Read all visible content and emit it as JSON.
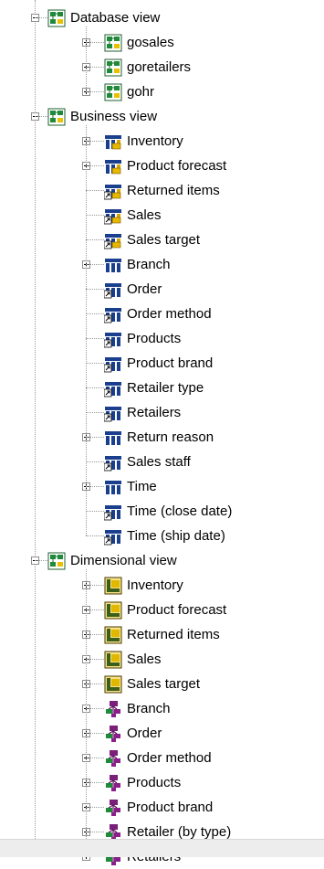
{
  "tree": {
    "groups": [
      {
        "label": "Database view",
        "icon": "namespace-icon",
        "children": [
          {
            "label": "gosales",
            "icon": "namespace-icon",
            "expandable": true
          },
          {
            "label": "goretailers",
            "icon": "namespace-icon",
            "expandable": true
          },
          {
            "label": "gohr",
            "icon": "namespace-icon",
            "expandable": true
          }
        ]
      },
      {
        "label": "Business view",
        "icon": "namespace-icon",
        "children": [
          {
            "label": "Inventory",
            "icon": "fact-query-subject-icon",
            "expandable": true
          },
          {
            "label": "Product forecast",
            "icon": "fact-query-subject-icon",
            "expandable": true
          },
          {
            "label": "Returned items",
            "icon": "fact-query-subject-shortcut-icon",
            "expandable": false
          },
          {
            "label": "Sales",
            "icon": "fact-query-subject-shortcut-icon",
            "expandable": false
          },
          {
            "label": "Sales target",
            "icon": "fact-query-subject-shortcut-icon",
            "expandable": false
          },
          {
            "label": "Branch",
            "icon": "dimension-query-subject-icon",
            "expandable": true
          },
          {
            "label": "Order",
            "icon": "dimension-query-subject-shortcut-icon",
            "expandable": false
          },
          {
            "label": "Order method",
            "icon": "dimension-query-subject-shortcut-icon",
            "expandable": false
          },
          {
            "label": "Products",
            "icon": "dimension-query-subject-shortcut-icon",
            "expandable": false
          },
          {
            "label": "Product brand",
            "icon": "dimension-query-subject-shortcut-icon",
            "expandable": false
          },
          {
            "label": "Retailer type",
            "icon": "dimension-query-subject-shortcut-icon",
            "expandable": false
          },
          {
            "label": "Retailers",
            "icon": "dimension-query-subject-shortcut-icon",
            "expandable": false
          },
          {
            "label": "Return reason",
            "icon": "dimension-query-subject-icon",
            "expandable": true
          },
          {
            "label": "Sales staff",
            "icon": "dimension-query-subject-shortcut-icon",
            "expandable": false
          },
          {
            "label": "Time",
            "icon": "dimension-query-subject-icon",
            "expandable": true
          },
          {
            "label": "Time (close date)",
            "icon": "dimension-query-subject-shortcut-icon",
            "expandable": false
          },
          {
            "label": "Time (ship date)",
            "icon": "dimension-query-subject-shortcut-icon",
            "expandable": false
          }
        ]
      },
      {
        "label": "Dimensional view",
        "icon": "namespace-icon",
        "children": [
          {
            "label": "Inventory",
            "icon": "measure-dimension-icon",
            "expandable": true
          },
          {
            "label": "Product forecast",
            "icon": "measure-dimension-icon",
            "expandable": true
          },
          {
            "label": "Returned items",
            "icon": "measure-dimension-icon",
            "expandable": true
          },
          {
            "label": "Sales",
            "icon": "measure-dimension-icon",
            "expandable": true
          },
          {
            "label": "Sales target",
            "icon": "measure-dimension-icon",
            "expandable": true
          },
          {
            "label": "Branch",
            "icon": "regular-dimension-icon",
            "expandable": true
          },
          {
            "label": "Order",
            "icon": "regular-dimension-icon",
            "expandable": true
          },
          {
            "label": "Order method",
            "icon": "regular-dimension-icon",
            "expandable": true
          },
          {
            "label": "Products",
            "icon": "regular-dimension-icon",
            "expandable": true
          },
          {
            "label": "Product brand",
            "icon": "regular-dimension-icon",
            "expandable": true
          },
          {
            "label": "Retailer (by type)",
            "icon": "regular-dimension-icon",
            "expandable": true
          },
          {
            "label": "Retailers",
            "icon": "regular-dimension-icon",
            "expandable": true
          }
        ]
      }
    ]
  },
  "colors": {
    "namespace": "#1f8a3a",
    "table": "#1b3f8f",
    "fact": "#d9a400",
    "measure": "#c9a000",
    "dimension": "#8a1f8a",
    "connector": "#9a9a9a"
  }
}
